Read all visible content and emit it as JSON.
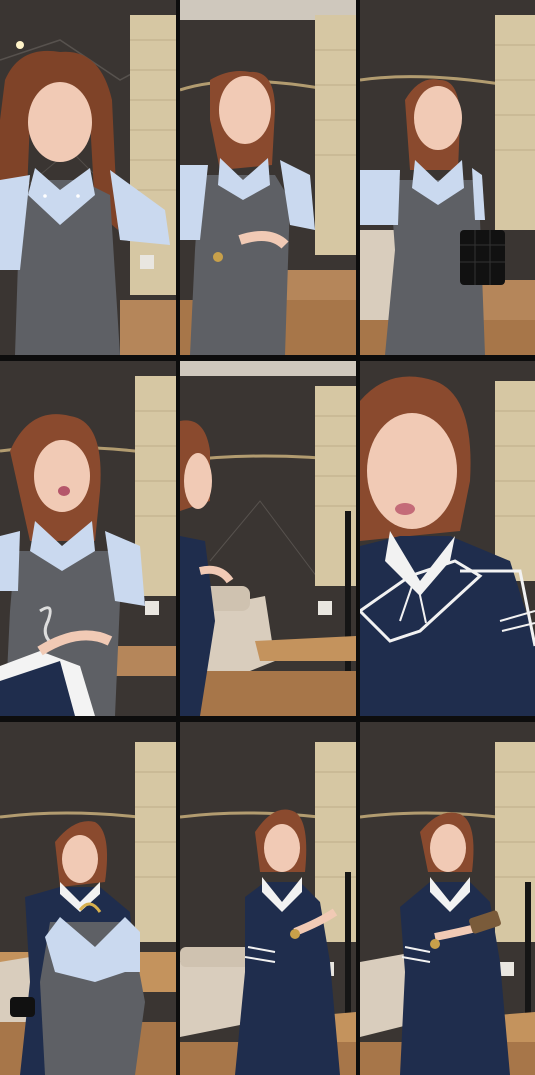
{
  "grid": {
    "columns": 3,
    "rows": 3
  },
  "frames": [
    {
      "id": "frame-1",
      "outfit": "grey-dress-light-blue-sleeves",
      "shot": "close-up"
    },
    {
      "id": "frame-2",
      "outfit": "grey-dress-light-blue-sleeves",
      "shot": "medium"
    },
    {
      "id": "frame-3",
      "outfit": "grey-dress-light-blue-sleeves",
      "shot": "medium-with-handbag"
    },
    {
      "id": "frame-4",
      "outfit": "grey-dress-light-blue-sleeves",
      "shot": "holding-hanger"
    },
    {
      "id": "frame-5",
      "outfit": "navy-dress",
      "shot": "room-side-view"
    },
    {
      "id": "frame-6",
      "outfit": "navy-sailor-dress",
      "shot": "close-up"
    },
    {
      "id": "frame-7",
      "outfit": "navy-sailor-dress",
      "shot": "holding-grey-dress"
    },
    {
      "id": "frame-8",
      "outfit": "navy-sailor-dress",
      "shot": "full-with-phone"
    },
    {
      "id": "frame-9",
      "outfit": "navy-sailor-dress",
      "shot": "full-with-phone"
    }
  ],
  "colors": {
    "wall_marble": "#3b3633",
    "blind": "#d8c9a6",
    "floor_wood": "#b98a55",
    "skin": "#f0c9b3",
    "hair": "#8a4a2e",
    "grey_dress": "#5f6166",
    "light_blue": "#c9d9ee",
    "navy": "#1f2d4d",
    "white": "#f2f2f2",
    "bed": "#d9cdbd"
  }
}
